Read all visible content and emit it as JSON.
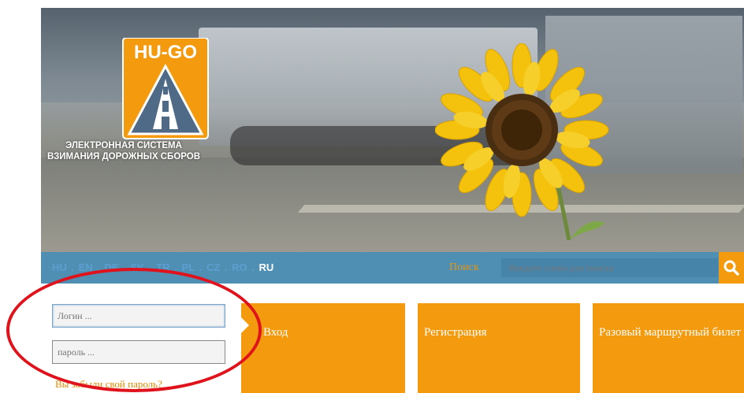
{
  "logo": {
    "brand": "HU-GO",
    "tagline": "ЭЛЕКТРОННАЯ СИСТЕМА ВЗИМАНИЯ ДОРОЖНЫХ СБОРОВ"
  },
  "languages": [
    {
      "code": "HU",
      "active": false
    },
    {
      "code": "EN",
      "active": false
    },
    {
      "code": "DE",
      "active": false
    },
    {
      "code": "SK",
      "active": false
    },
    {
      "code": "TR",
      "active": false
    },
    {
      "code": "PL",
      "active": false
    },
    {
      "code": "CZ",
      "active": false
    },
    {
      "code": "RO",
      "active": false
    },
    {
      "code": "RU",
      "active": true
    }
  ],
  "lang_separator": " . ",
  "search": {
    "label": "Поиск",
    "placeholder": "Введите слово для поиска",
    "icon": "search-icon"
  },
  "login": {
    "login_placeholder": "Логин ...",
    "password_placeholder": "пароль ...",
    "forgot_link": "Вы забыли свой пароль?"
  },
  "tiles": {
    "enter": "Вход",
    "register": "Регистрация",
    "route_ticket": "Разовый маршрутный билет"
  },
  "colors": {
    "orange": "#f39a0f",
    "lang_bar": "#4f8fb4",
    "highlight_oval": "#e0121b"
  }
}
